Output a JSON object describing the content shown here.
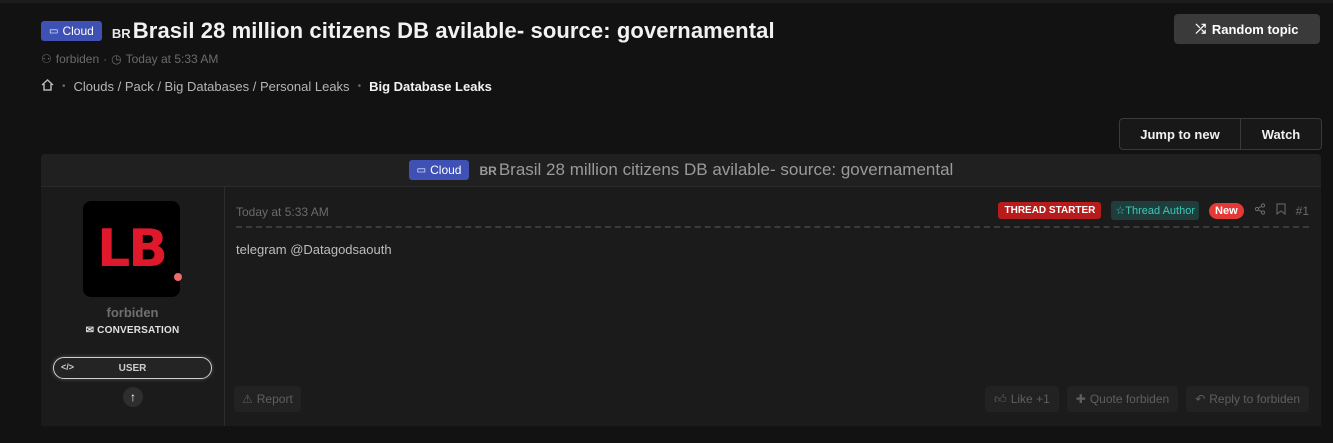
{
  "thread": {
    "prefix": "Cloud",
    "flag": "BR",
    "title": "Brasil 28 million citizens DB avilable- source: governamental",
    "author": "forbiden",
    "time": "Today at 5:33 AM"
  },
  "breadcrumb": {
    "path": "Clouds / Pack / Big Databases / Personal Leaks",
    "current": "Big Database Leaks"
  },
  "buttons": {
    "random_topic": "Random topic",
    "jump_to_new": "Jump to new",
    "watch": "Watch"
  },
  "user": {
    "avatar_text": "LB",
    "name": "forbiden",
    "status": "CONVERSATION",
    "role": "USER"
  },
  "post": {
    "time": "Today at 5:33 AM",
    "tag_starter": "THREAD STARTER",
    "tag_author": "Thread Author",
    "tag_new": "New",
    "number": "#1",
    "message": "telegram @Datagodsaouth",
    "report": "Report",
    "like": "Like +1",
    "quote": "Quote forbiden",
    "reply": "Reply to forbiden"
  },
  "colors": {
    "background": "#121212",
    "prefix_badge": "#3f51b5",
    "thread_starter": "#b71c1c",
    "thread_author": "#3ec7b8",
    "new_badge": "#e53935",
    "avatar_logo": "#e0182c"
  },
  "icons": [
    "briefcase-icon",
    "user-icon",
    "clock-icon",
    "home-icon",
    "shuffle-icon",
    "envelope-icon",
    "code-icon",
    "arrow-up-icon",
    "star-icon",
    "share-icon",
    "bookmark-icon",
    "warning-icon",
    "thumbs-up-icon",
    "plus-icon",
    "reply-icon"
  ]
}
